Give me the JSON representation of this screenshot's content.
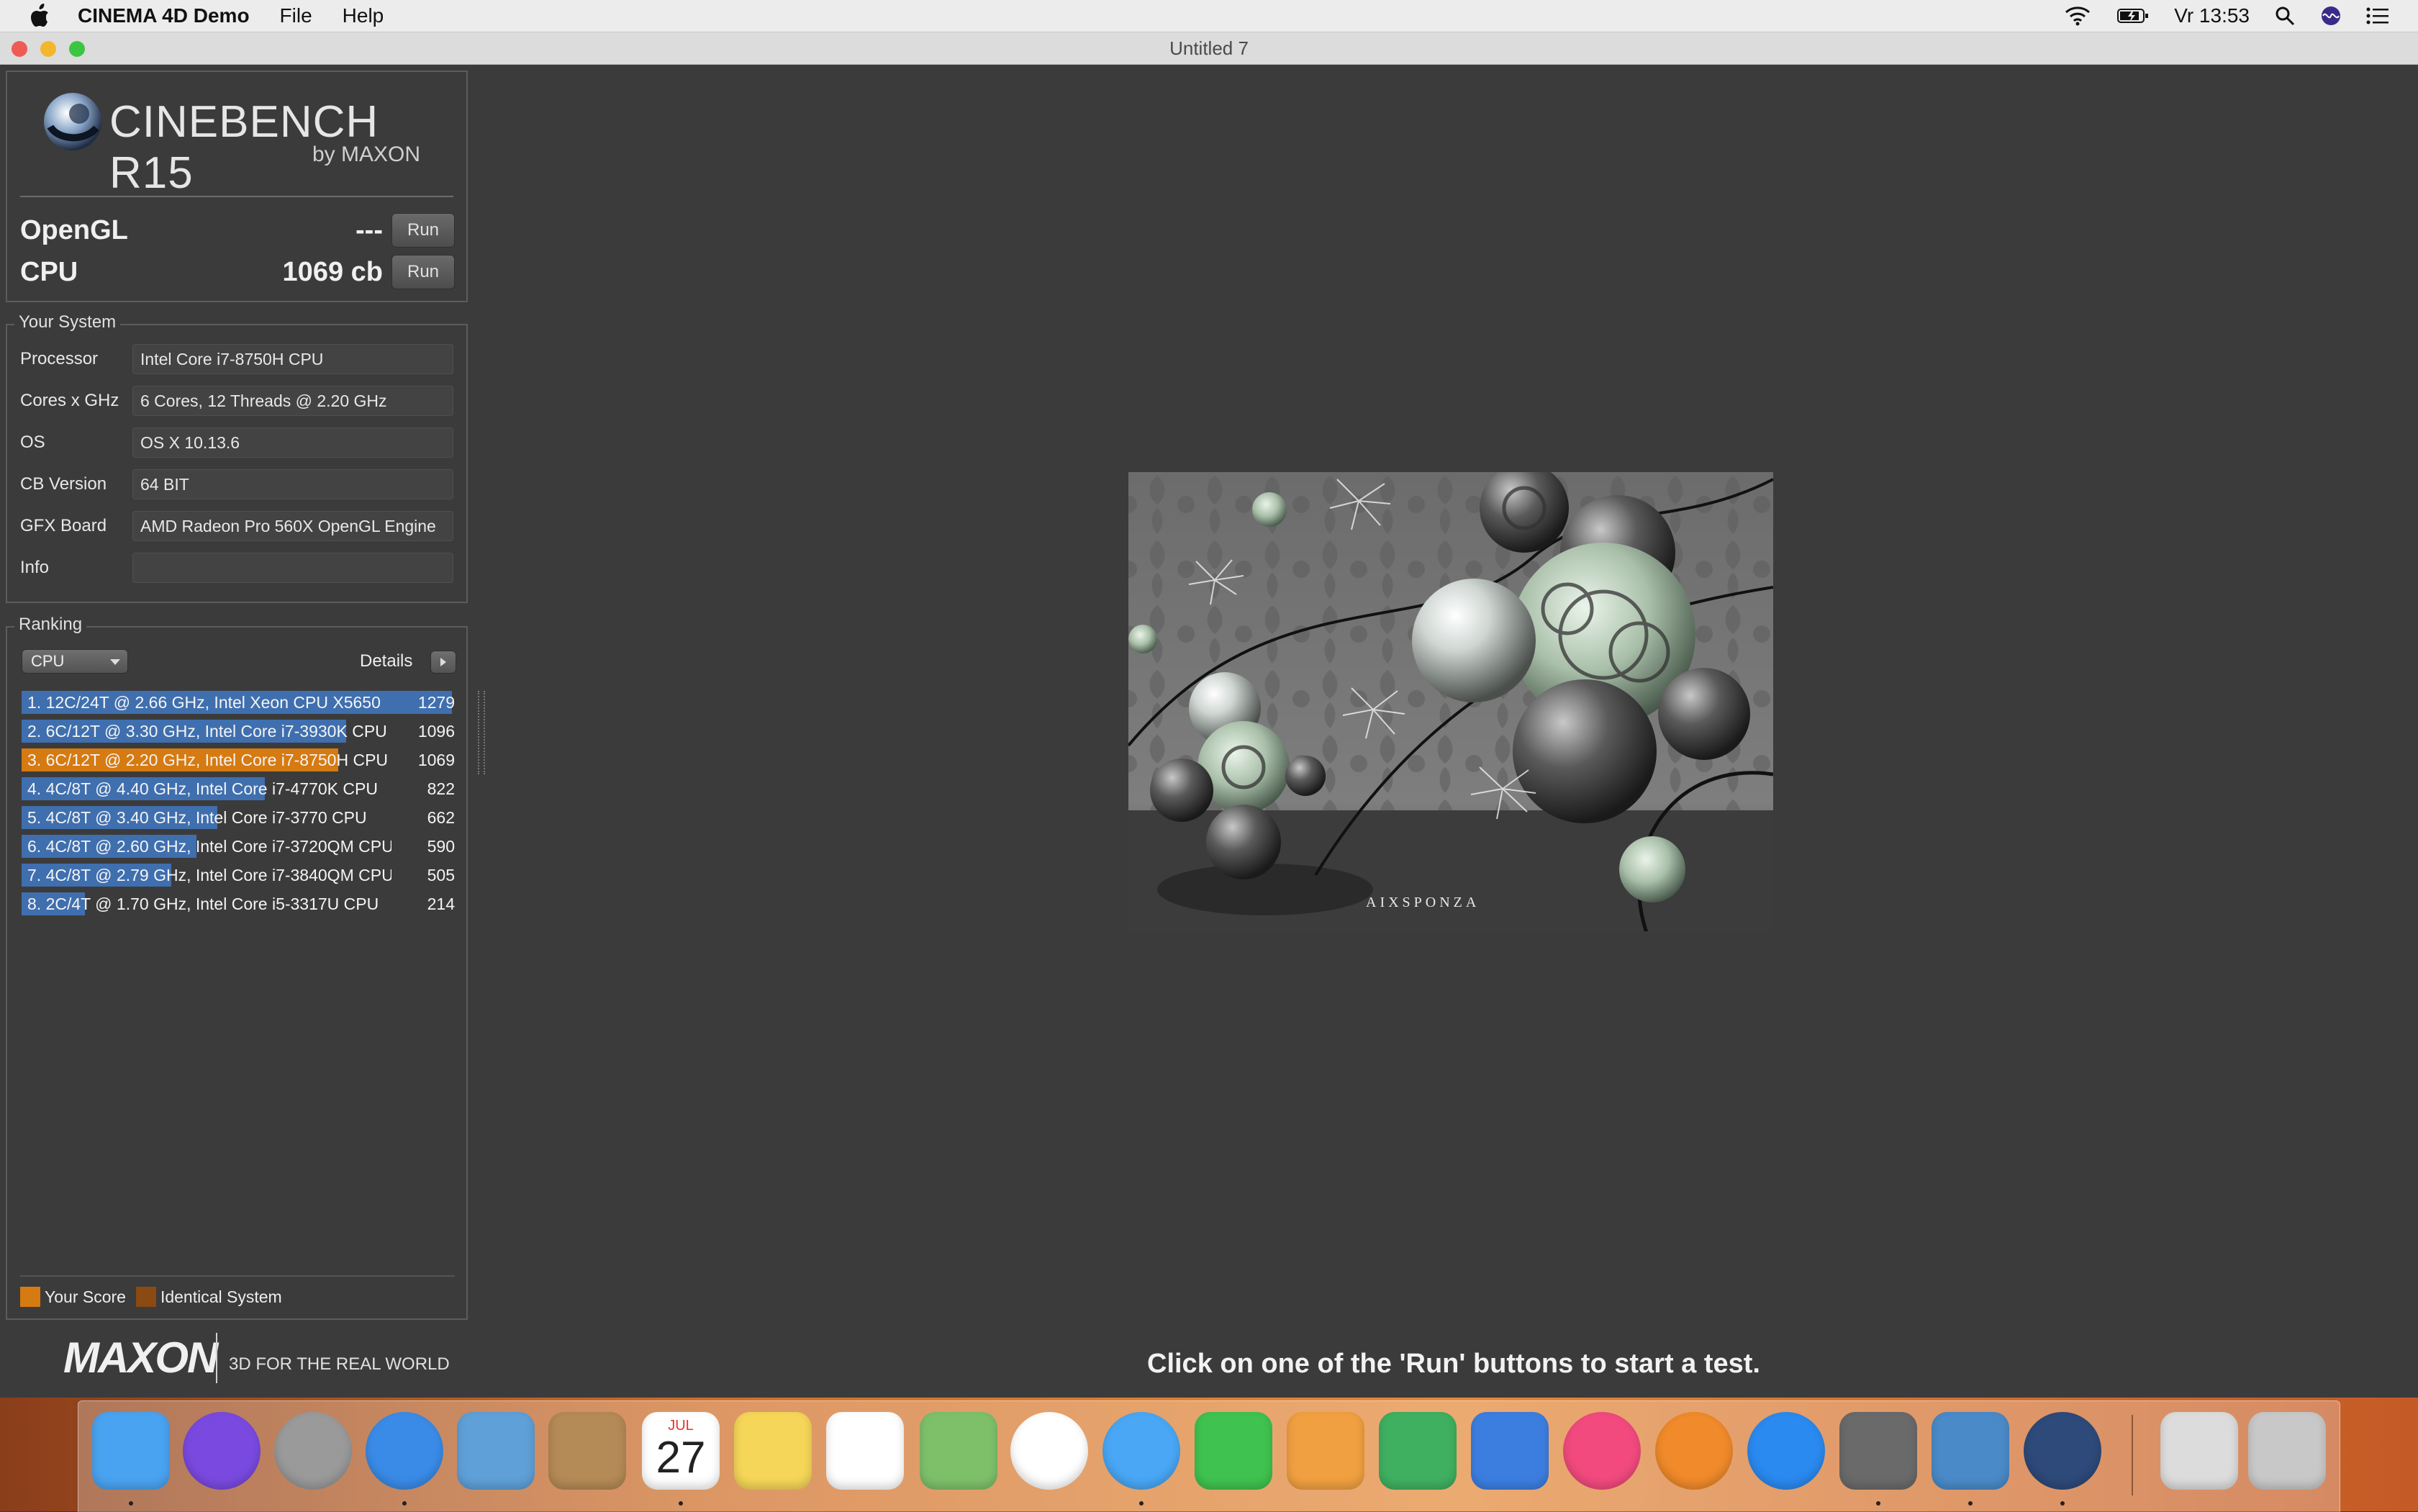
{
  "menubar": {
    "app_name": "CINEMA 4D Demo",
    "menus": [
      "File",
      "Help"
    ],
    "clock": "Vr 13:53"
  },
  "window": {
    "title": "Untitled 7"
  },
  "logo": {
    "word": "CINEBENCH R15",
    "by": "by MAXON"
  },
  "benchmarks": {
    "opengl": {
      "label": "OpenGL",
      "value": "---",
      "button": "Run"
    },
    "cpu": {
      "label": "CPU",
      "value": "1069 cb",
      "button": "Run"
    }
  },
  "system": {
    "title": "Your System",
    "rows": [
      {
        "label": "Processor",
        "value": "Intel Core i7-8750H CPU"
      },
      {
        "label": "Cores x GHz",
        "value": "6 Cores, 12 Threads @ 2.20 GHz"
      },
      {
        "label": "OS",
        "value": "OS X 10.13.6"
      },
      {
        "label": "CB Version",
        "value": "64 BIT"
      },
      {
        "label": "GFX Board",
        "value": "AMD Radeon Pro 560X OpenGL Engine"
      },
      {
        "label": "Info",
        "value": ""
      }
    ]
  },
  "ranking": {
    "title": "Ranking",
    "dropdown": "CPU",
    "details_label": "Details",
    "items": [
      {
        "text": "1. 12C/24T @ 2.66 GHz, Intel Xeon CPU X5650",
        "score": 1279,
        "you": false
      },
      {
        "text": "2. 6C/12T @ 3.30 GHz,  Intel Core i7-3930K CPU",
        "score": 1096,
        "you": false
      },
      {
        "text": "3. 6C/12T @ 2.20 GHz, Intel Core i7-8750H CPU",
        "score": 1069,
        "you": true
      },
      {
        "text": "4. 4C/8T @ 4.40 GHz, Intel Core i7-4770K CPU",
        "score": 822,
        "you": false
      },
      {
        "text": "5. 4C/8T @ 3.40 GHz,  Intel Core i7-3770 CPU",
        "score": 662,
        "you": false
      },
      {
        "text": "6. 4C/8T @ 2.60 GHz, Intel Core i7-3720QM CPU",
        "score": 590,
        "you": false
      },
      {
        "text": "7. 4C/8T @ 2.79 GHz,  Intel Core i7-3840QM CPU",
        "score": 505,
        "you": false
      },
      {
        "text": "8. 2C/4T @ 1.70 GHz,  Intel Core i5-3317U CPU",
        "score": 214,
        "you": false
      }
    ],
    "legend": {
      "your_score": "Your Score",
      "identical": "Identical System",
      "your_color": "#d67a12",
      "identical_color": "#8a4a12"
    }
  },
  "footer": {
    "brand": "MAXON",
    "tagline": "3D FOR THE REAL WORLD",
    "status": "Click on one of the 'Run' buttons to start a test."
  },
  "render": {
    "watermark": "AIXSPONZA"
  },
  "dock": {
    "calendar_month": "JUL",
    "calendar_day": "27",
    "apps": [
      "finder-icon",
      "siri-icon",
      "launchpad-icon",
      "safari-icon",
      "mail-icon",
      "contacts-icon",
      "calendar-icon",
      "notes-icon",
      "reminders-icon",
      "maps-icon",
      "photos-icon",
      "messages-icon",
      "facetime-icon",
      "pages-icon",
      "numbers-icon",
      "keynote-icon",
      "itunes-icon",
      "ibooks-icon",
      "app-store-icon",
      "system-preferences-icon",
      "istat-icon",
      "cinebench-icon",
      "downloads-stack-icon",
      "trash-icon"
    ]
  }
}
